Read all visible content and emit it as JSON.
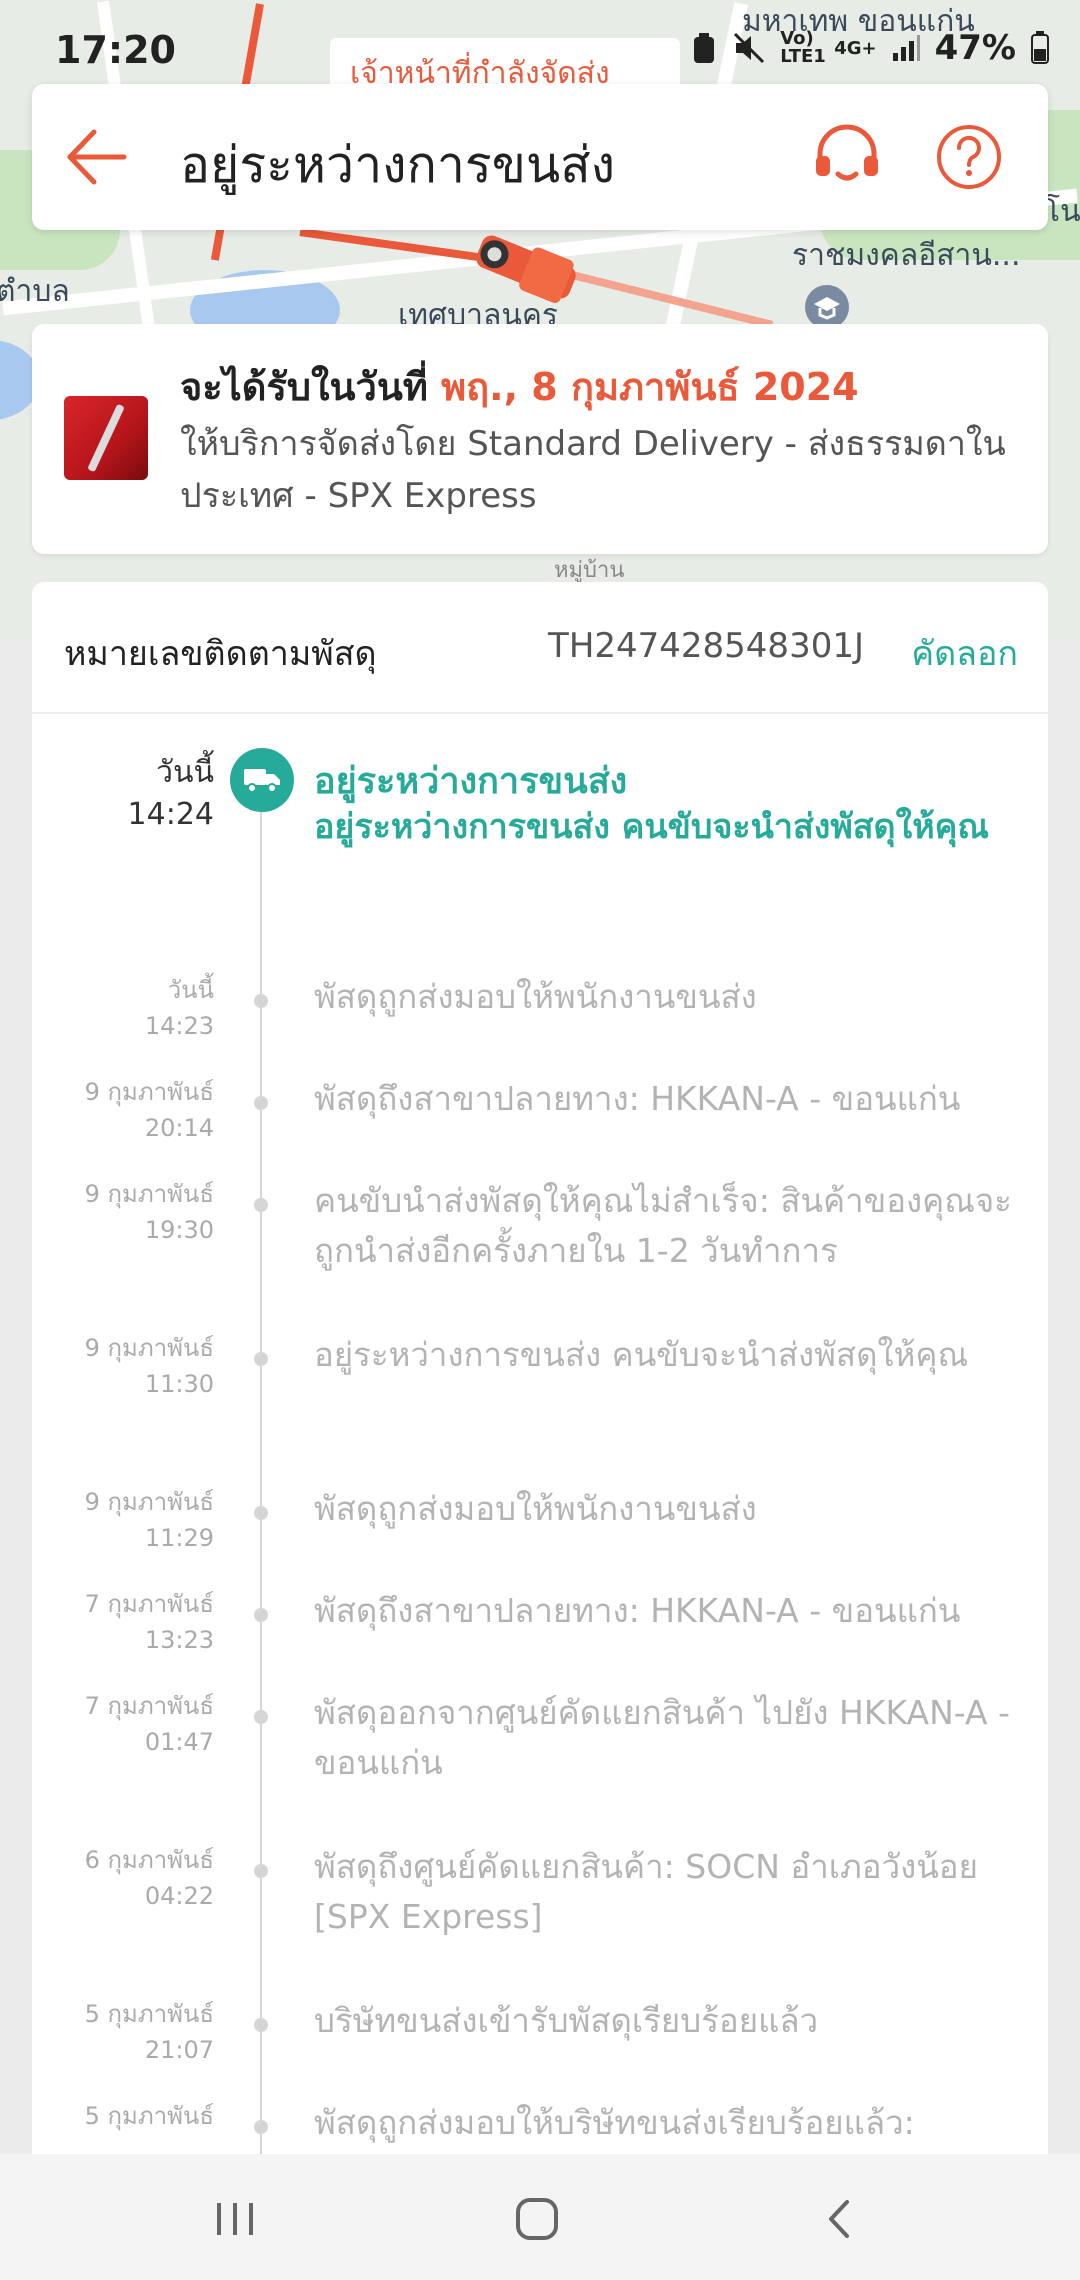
{
  "status_bar": {
    "time": "17:20",
    "battery": "47%",
    "network_label": "Vo) LTE1",
    "signal_label": "4G+"
  },
  "map": {
    "place_tag": "เจ้าหน้าที่กำลังจัดส่ง",
    "labels": [
      "มหาเทพ ขอนแก่น",
      "ราชมงคลอีสาน...",
      "ตำบล",
      "เทศบาลนคร",
      "หมู่บ้าน",
      "โน"
    ]
  },
  "header": {
    "title": "อยู่ระหว่างการขนส่ง"
  },
  "delivery": {
    "eta_prefix": "จะได้รับในวันที่ ",
    "eta_date": "พฤ., 8 กุมภาพันธ์ 2024",
    "service": "ให้บริการจัดส่งโดย Standard Delivery - ส่งธรรมดาในประเทศ - SPX Express"
  },
  "tracking": {
    "label": "หมายเลขติดตามพัสดุ",
    "number": "TH247428548301J",
    "copy_label": "คัดลอก"
  },
  "current_event": {
    "day": "วันนี้",
    "time": "14:24",
    "title": "อยู่ระหว่างการขนส่ง",
    "description": "อยู่ระหว่างการขนส่ง คนขับจะนำส่งพัสดุให้คุณ"
  },
  "events": [
    {
      "day": "วันนี้",
      "time": "14:23",
      "description": "พัสดุถูกส่งมอบให้พนักงานขนส่ง"
    },
    {
      "day": "9 กุมภาพันธ์",
      "time": "20:14",
      "description": "พัสดุถึงสาขาปลายทาง: HKKAN-A - ขอนแก่น"
    },
    {
      "day": "9 กุมภาพันธ์",
      "time": "19:30",
      "description": "คนขับนำส่งพัสดุให้คุณไม่สำเร็จ: สินค้าของคุณจะถูกนำส่งอีกครั้งภายใน 1-2 วันทำการ"
    },
    {
      "day": "9 กุมภาพันธ์",
      "time": "11:30",
      "description": "อยู่ระหว่างการขนส่ง คนขับจะนำส่งพัสดุให้คุณ"
    },
    {
      "day": "9 กุมภาพันธ์",
      "time": "11:29",
      "description": "พัสดุถูกส่งมอบให้พนักงานขนส่ง"
    },
    {
      "day": "7 กุมภาพันธ์",
      "time": "13:23",
      "description": "พัสดุถึงสาขาปลายทาง: HKKAN-A - ขอนแก่น"
    },
    {
      "day": "7 กุมภาพันธ์",
      "time": "01:47",
      "description": "พัสดุออกจากศูนย์คัดแยกสินค้า ไปยัง HKKAN-A - ขอนแก่น"
    },
    {
      "day": "6 กุมภาพันธ์",
      "time": "04:22",
      "description": "พัสดุถึงศูนย์คัดแยกสินค้า: SOCN อำเภอวังน้อย [SPX Express]"
    },
    {
      "day": "5 กุมภาพันธ์",
      "time": "21:07",
      "description": "บริษัทขนส่งเข้ารับพัสดุเรียบร้อยแล้ว"
    },
    {
      "day": "5 กุมภาพันธ์",
      "time": "",
      "description": "พัสดุถูกส่งมอบให้บริษัทขนส่งเรียบร้อยแล้ว:"
    }
  ],
  "colors": {
    "accent": "#e9593a",
    "teal": "#26aa99",
    "muted": "#b3b3b3"
  },
  "icons": {
    "back": "arrow-left-icon",
    "support": "headset-icon",
    "help": "question-circle-icon",
    "truck": "truck-icon",
    "nav_recents": "recents-icon",
    "nav_home": "home-icon",
    "nav_back": "chevron-left-icon"
  }
}
